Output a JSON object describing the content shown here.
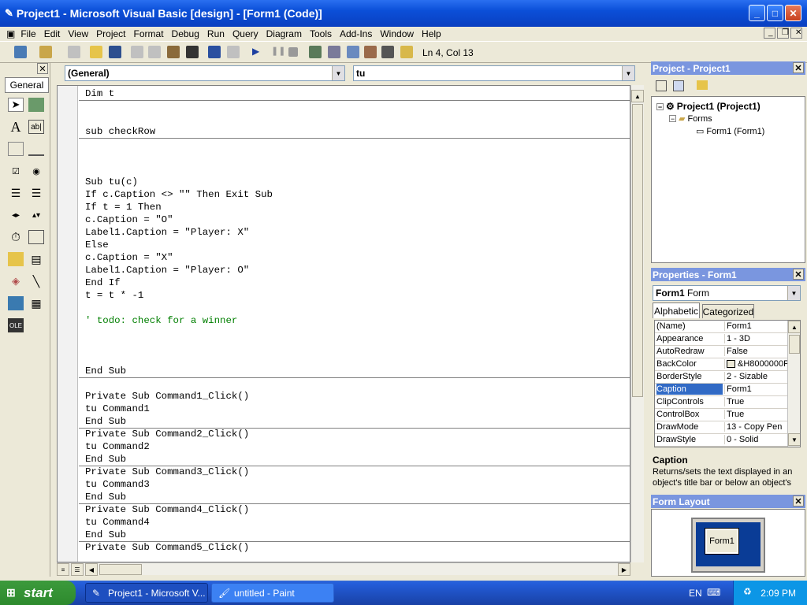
{
  "window": {
    "title": "Project1 - Microsoft Visual Basic [design] - [Form1 (Code)]"
  },
  "menu": [
    "File",
    "Edit",
    "View",
    "Project",
    "Format",
    "Debug",
    "Run",
    "Query",
    "Diagram",
    "Tools",
    "Add-Ins",
    "Window",
    "Help"
  ],
  "toolbar": {
    "position": "Ln 4, Col 13"
  },
  "toolbox": {
    "title": "General"
  },
  "editor": {
    "object_dropdown": "(General)",
    "procedure_dropdown": "tu",
    "lines": [
      "Dim t",
      "",
      "",
      "sub checkRow",
      "",
      "",
      "",
      "Sub tu(c)",
      "If c.Caption <> \"\" Then Exit Sub",
      "If t = 1 Then",
      "c.Caption = \"O\"",
      "Label1.Caption = \"Player: X\"",
      "Else",
      "c.Caption = \"X\"",
      "Label1.Caption = \"Player: O\"",
      "End If",
      "t = t * -1",
      "",
      "' todo: check for a winner",
      "",
      "",
      "",
      "End Sub",
      "",
      "Private Sub Command1_Click()",
      "tu Command1",
      "End Sub",
      "Private Sub Command2_Click()",
      "tu Command2",
      "End Sub",
      "Private Sub Command3_Click()",
      "tu Command3",
      "End Sub",
      "Private Sub Command4_Click()",
      "tu Command4",
      "End Sub",
      "Private Sub Command5_Click()"
    ]
  },
  "project": {
    "title": "Project - Project1",
    "root": "Project1 (Project1)",
    "folder": "Forms",
    "item": "Form1 (Form1)"
  },
  "properties": {
    "title": "Properties - Form1",
    "object_name": "Form1",
    "object_type": "Form",
    "tab_alpha": "Alphabetic",
    "tab_cat": "Categorized",
    "rows": [
      {
        "name": "(Name)",
        "value": "Form1"
      },
      {
        "name": "Appearance",
        "value": "1 - 3D"
      },
      {
        "name": "AutoRedraw",
        "value": "False"
      },
      {
        "name": "BackColor",
        "value": "&H8000000F"
      },
      {
        "name": "BorderStyle",
        "value": "2 - Sizable"
      },
      {
        "name": "Caption",
        "value": "Form1"
      },
      {
        "name": "ClipControls",
        "value": "True"
      },
      {
        "name": "ControlBox",
        "value": "True"
      },
      {
        "name": "DrawMode",
        "value": "13 - Copy Pen"
      },
      {
        "name": "DrawStyle",
        "value": "0 - Solid"
      }
    ],
    "desc_title": "Caption",
    "desc_text": "Returns/sets the text displayed in an object's title bar or below an object's"
  },
  "form_layout": {
    "title": "Form Layout",
    "form_label": "Form1"
  },
  "taskbar": {
    "start": "start",
    "tasks": [
      "Project1 - Microsoft V...",
      "untitled - Paint"
    ],
    "lang": "EN",
    "clock": "2:09 PM"
  }
}
